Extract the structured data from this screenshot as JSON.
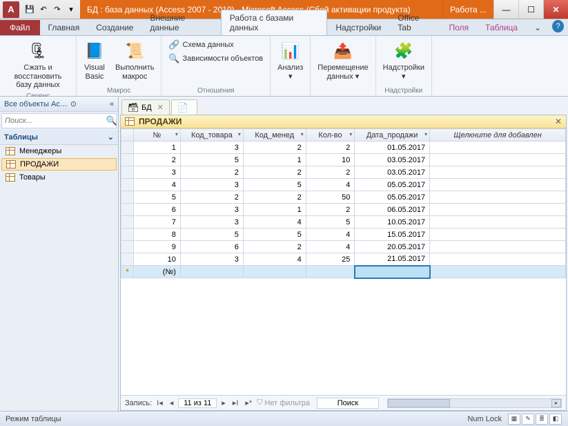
{
  "title": "БД : база данных (Access 2007 - 2010) - Microsoft Access (Сбой активации продукта)",
  "context_tab": "Работа ...",
  "qat_icons": [
    "save-icon",
    "undo-icon",
    "redo-icon",
    "dropdown-icon"
  ],
  "ribbon_tabs": {
    "file": "Файл",
    "items": [
      "Главная",
      "Создание",
      "Внешние данные",
      "Работа с базами данных",
      "Надстройки",
      "Office Tab"
    ],
    "context_items": [
      "Поля",
      "Таблица"
    ],
    "active": "Работа с базами данных"
  },
  "ribbon": {
    "groups": [
      {
        "title": "Сервис",
        "big": [
          {
            "icon": "compact-icon",
            "label": "Сжать и восстановить\nбазу данных"
          }
        ]
      },
      {
        "title": "Макрос",
        "big": [
          {
            "icon": "vb-icon",
            "label": "Visual\nBasic"
          },
          {
            "icon": "macro-icon",
            "label": "Выполнить\nмакрос"
          }
        ]
      },
      {
        "title": "Отношения",
        "list": [
          {
            "icon": "schema-icon",
            "label": "Схема данных"
          },
          {
            "icon": "deps-icon",
            "label": "Зависимости объектов"
          }
        ]
      },
      {
        "title": "",
        "big": [
          {
            "icon": "analyze-icon",
            "label": "Анализ\n▾"
          }
        ]
      },
      {
        "title": "",
        "big": [
          {
            "icon": "move-icon",
            "label": "Перемещение\nданных ▾"
          }
        ]
      },
      {
        "title": "Надстройки",
        "big": [
          {
            "icon": "addins-icon",
            "label": "Надстройки\n▾"
          }
        ]
      }
    ]
  },
  "nav": {
    "header": "Все объекты Ac…",
    "search_placeholder": "Поиск...",
    "group": "Таблицы",
    "items": [
      "Менеджеры",
      "ПРОДАЖИ",
      "Товары"
    ],
    "selected": "ПРОДАЖИ"
  },
  "doctabs": [
    {
      "icon": "db-icon",
      "label": "БД",
      "closable": true
    },
    {
      "icon": "new-icon",
      "label": "",
      "closable": false
    }
  ],
  "table": {
    "title": "ПРОДАЖИ",
    "columns": [
      "№",
      "Код_товара",
      "Код_менед",
      "Кол-во",
      "Дата_продажи"
    ],
    "add_column": "Щелкните для добавлен",
    "rows": [
      [
        1,
        3,
        2,
        2,
        "01.05.2017"
      ],
      [
        2,
        5,
        1,
        10,
        "03.05.2017"
      ],
      [
        3,
        2,
        2,
        2,
        "03.05.2017"
      ],
      [
        4,
        3,
        5,
        4,
        "05.05.2017"
      ],
      [
        5,
        2,
        2,
        50,
        "05.05.2017"
      ],
      [
        6,
        3,
        1,
        2,
        "06.05.2017"
      ],
      [
        7,
        3,
        4,
        5,
        "10.05.2017"
      ],
      [
        8,
        5,
        5,
        4,
        "15.05.2017"
      ],
      [
        9,
        6,
        2,
        4,
        "20.05.2017"
      ],
      [
        10,
        3,
        4,
        25,
        "21.05.2017"
      ]
    ],
    "new_row_label": "(№)"
  },
  "recnav": {
    "label": "Запись:",
    "position": "11 из 11",
    "nofilter": "Нет фильтра",
    "search": "Поиск"
  },
  "status": {
    "mode": "Режим таблицы",
    "numlock": "Num Lock"
  }
}
